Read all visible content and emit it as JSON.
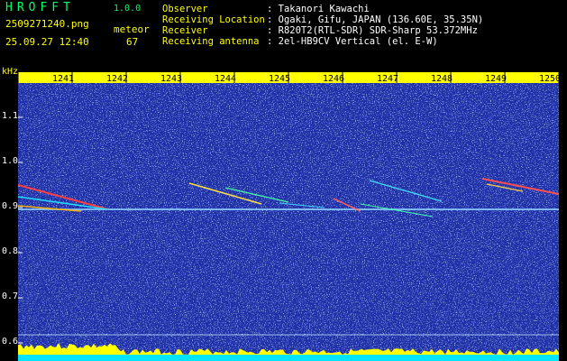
{
  "header": {
    "app_title": "HROFFT",
    "app_version": "1.0.0",
    "file_name": "2509271240.png",
    "timestamp": "25.09.27 12:40",
    "meteor_label": "meteor",
    "meteor_count": "67"
  },
  "info": [
    {
      "key": "Observer",
      "value": ": Takanori Kawachi"
    },
    {
      "key": "Receiving Location",
      "value": ": Ogaki, Gifu, JAPAN (136.60E, 35.35N)"
    },
    {
      "key": "Receiver",
      "value": ": R820T2(RTL-SDR) SDR-Sharp 53.372MHz"
    },
    {
      "key": "Receiving antenna",
      "value": ": 2el-HB9CV Vertical (el. E-W)"
    }
  ],
  "axis": {
    "y_unit": "kHz",
    "y_ticks": [
      "1.1",
      "1.0",
      "0.9",
      "0.8",
      "0.7",
      "0.6"
    ],
    "x_ticks": [
      "1241",
      "1242",
      "1243",
      "1244",
      "1245",
      "1246",
      "1247",
      "1248",
      "1249",
      "1250"
    ]
  },
  "colors": {
    "background": "#000000",
    "spectrum_base": "#1f2fa8",
    "axis_bar": "#ffff00",
    "label_yellow": "#ffff00",
    "label_green": "#00ff66"
  }
}
